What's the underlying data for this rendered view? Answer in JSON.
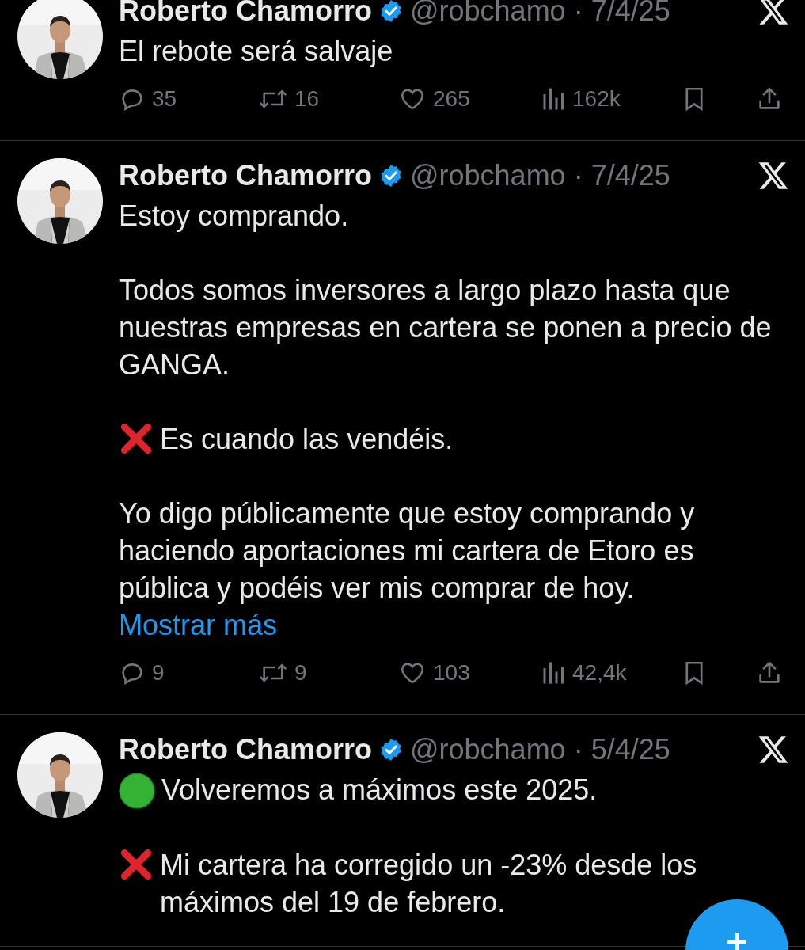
{
  "tweets": [
    {
      "name": "Roberto Chamorro",
      "meta": "@robchamo · 7/4/25",
      "paragraphs": [
        {
          "text": "El rebote será salvaje"
        }
      ],
      "actions": [
        {
          "kind": "reply",
          "count": "35"
        },
        {
          "kind": "repost",
          "count": "16"
        },
        {
          "kind": "like",
          "count": "265"
        },
        {
          "kind": "views",
          "count": "162k"
        },
        {
          "kind": "bookmark"
        },
        {
          "kind": "share"
        }
      ]
    },
    {
      "name": "Roberto Chamorro",
      "meta": "@robchamo · 7/4/25",
      "paragraphs": [
        {
          "text": "Estoy comprando."
        },
        {
          "text": "Todos somos inversores a largo plazo hasta que nuestras empresas en cartera se ponen a precio de GANGA."
        },
        {
          "kind": "cross",
          "text": "Es cuando las vendéis."
        },
        {
          "text": "Yo digo públicamente que estoy comprando y haciendo aportaciones mi cartera de Etoro es pública y podéis ver mis comprar de hoy.",
          "link": "Mostrar más"
        }
      ],
      "actions": [
        {
          "kind": "reply",
          "count": "9"
        },
        {
          "kind": "repost",
          "count": "9"
        },
        {
          "kind": "like",
          "count": "103"
        },
        {
          "kind": "views",
          "count": "42,4k"
        },
        {
          "kind": "bookmark"
        },
        {
          "kind": "share"
        }
      ]
    },
    {
      "name": "Roberto Chamorro",
      "meta": "@robchamo · 5/4/25",
      "paragraphs": [
        {
          "kind": "circle",
          "text": "Volveremos a máximos este 2025."
        },
        {
          "kind": "cross",
          "text": "Mi cartera ha corregido un -23% desde los máximos del 19 de febrero."
        }
      ]
    }
  ]
}
